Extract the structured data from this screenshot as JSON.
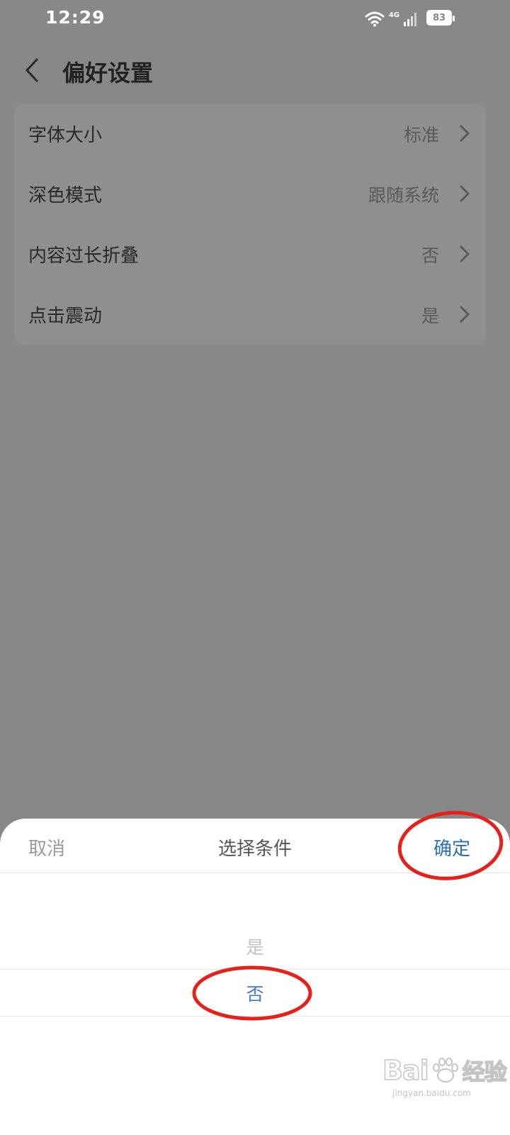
{
  "status_bar": {
    "time": "12:29",
    "network": "4G",
    "battery": "83",
    "icons": [
      "wifi-icon",
      "signal-icon",
      "battery-icon"
    ]
  },
  "header": {
    "title": "偏好设置",
    "back_icon": "chevron-left-icon"
  },
  "settings": {
    "rows": [
      {
        "label": "字体大小",
        "value": "标准"
      },
      {
        "label": "深色模式",
        "value": "跟随系统"
      },
      {
        "label": "内容过长折叠",
        "value": "否"
      },
      {
        "label": "点击震动",
        "value": "是"
      }
    ]
  },
  "sheet": {
    "cancel_label": "取消",
    "title": "选择条件",
    "confirm_label": "确定",
    "options": [
      "是",
      "否"
    ],
    "selected": "否"
  },
  "watermark": {
    "logo_text_left": "Bai",
    "logo_text_right": "经验",
    "url": "jingyan.baidu.com"
  },
  "colors": {
    "overlay": "#888888",
    "accent": "#3f7bc1",
    "annotation": "#e8201a"
  }
}
